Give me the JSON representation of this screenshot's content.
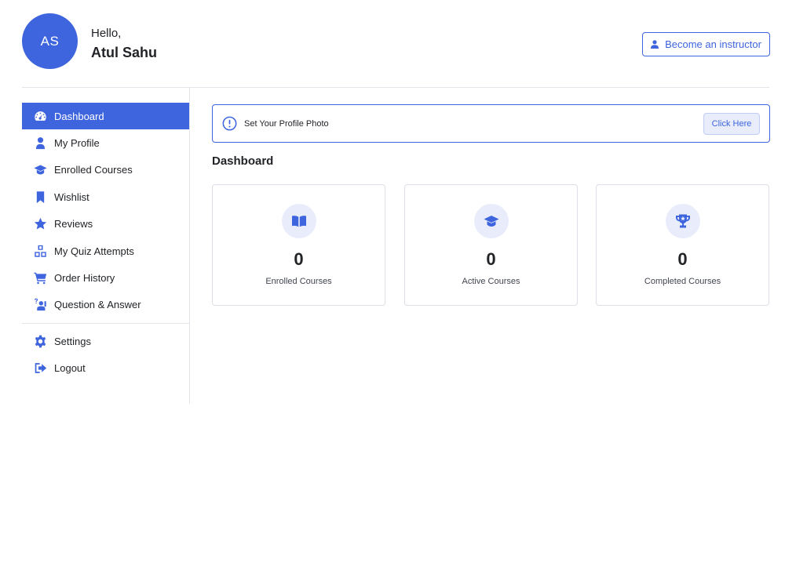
{
  "header": {
    "avatar_initials": "AS",
    "greeting": "Hello,",
    "user_name": "Atul Sahu",
    "instructor_button_label": "Become an instructor"
  },
  "sidebar": {
    "items": [
      {
        "label": "Dashboard",
        "icon": "dashboard-icon",
        "active": true
      },
      {
        "label": "My Profile",
        "icon": "user-icon"
      },
      {
        "label": "Enrolled Courses",
        "icon": "graduation-cap-icon"
      },
      {
        "label": "Wishlist",
        "icon": "bookmark-icon"
      },
      {
        "label": "Reviews",
        "icon": "star-icon"
      },
      {
        "label": "My Quiz Attempts",
        "icon": "quiz-cubes-icon"
      },
      {
        "label": "Order History",
        "icon": "cart-icon"
      },
      {
        "label": "Question & Answer",
        "icon": "question-person-icon"
      }
    ],
    "bottom_items": [
      {
        "label": "Settings",
        "icon": "gear-icon"
      },
      {
        "label": "Logout",
        "icon": "logout-icon"
      }
    ]
  },
  "alert": {
    "text": "Set Your Profile Photo",
    "button_label": "Click Here"
  },
  "main": {
    "title": "Dashboard",
    "cards": [
      {
        "value": "0",
        "label": "Enrolled Courses",
        "icon": "book-open-icon"
      },
      {
        "value": "0",
        "label": "Active Courses",
        "icon": "graduation-cap-icon"
      },
      {
        "value": "0",
        "label": "Completed Courses",
        "icon": "trophy-icon"
      }
    ]
  },
  "colors": {
    "accent": "#3e64de",
    "accent_light": "#e9edfb",
    "border": "#e3e5eb",
    "text": "#212327"
  }
}
